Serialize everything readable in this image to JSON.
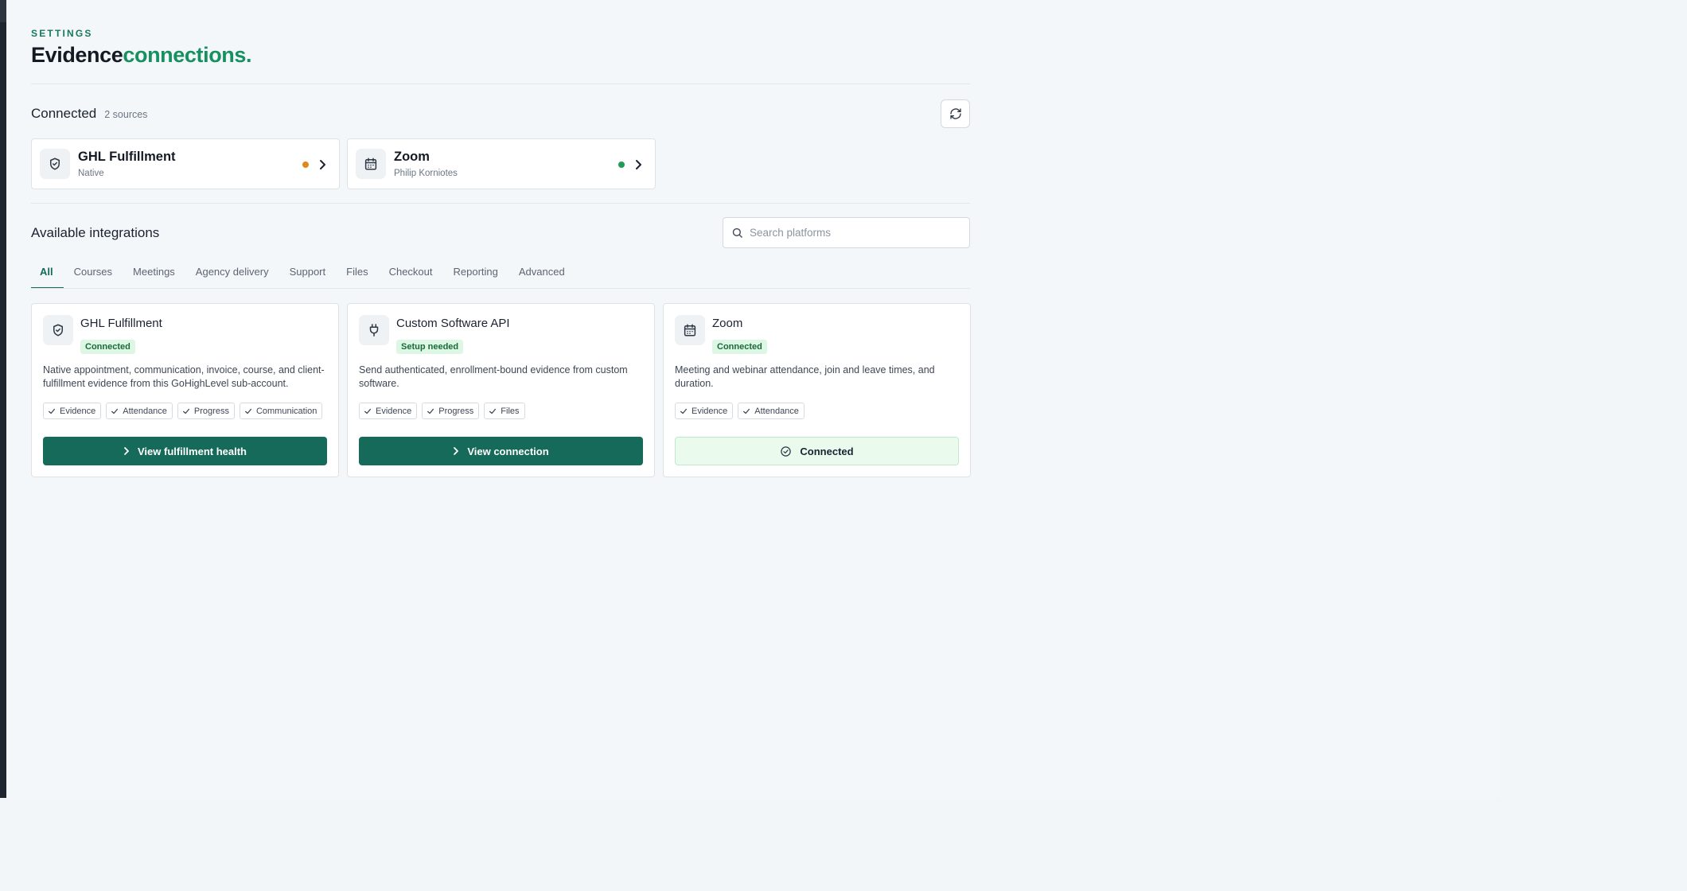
{
  "header": {
    "eyebrow": "SETTINGS",
    "title_part1": "Evidence",
    "title_part2": "connections."
  },
  "connected": {
    "title": "Connected",
    "count": "2 sources",
    "refresh_icon": "refresh-icon",
    "sources": [
      {
        "name": "GHL Fulfillment",
        "meta": "Native",
        "icon": "shield-check-icon",
        "status_color": "#e08a16"
      },
      {
        "name": "Zoom",
        "meta": "Philip Korniotes",
        "icon": "calendar-icon",
        "status_color": "#1f9d55"
      }
    ]
  },
  "available": {
    "title": "Available integrations",
    "search_placeholder": "Search platforms",
    "search_icon": "search-icon",
    "tabs": [
      "All",
      "Courses",
      "Meetings",
      "Agency delivery",
      "Support",
      "Files",
      "Checkout",
      "Reporting",
      "Advanced"
    ],
    "active_tab": "All",
    "integrations": [
      {
        "name": "GHL Fulfillment",
        "icon": "shield-check-icon",
        "badge": "Connected",
        "description": "Native appointment, communication, invoice, course, and client-fulfillment evidence from this GoHighLevel sub-account.",
        "chips": [
          "Evidence",
          "Attendance",
          "Progress",
          "Communication"
        ],
        "action": "View fulfillment health"
      },
      {
        "name": "Custom Software API",
        "icon": "plug-icon",
        "badge": "Setup needed",
        "description": "Send authenticated, enrollment-bound evidence from custom software.",
        "chips": [
          "Evidence",
          "Progress",
          "Files"
        ],
        "action": "View connection"
      },
      {
        "name": "Zoom",
        "icon": "calendar-icon",
        "badge": "Connected",
        "description": "Meeting and webinar attendance, join and leave times, and duration.",
        "chips": [
          "Evidence",
          "Attendance"
        ],
        "action": "Connected"
      }
    ]
  },
  "colors": {
    "accent": "#166a5a",
    "brand_green": "#16905f",
    "badge_bg": "#def7e5",
    "status_warn": "#e08a16",
    "status_ok": "#1f9d55"
  }
}
